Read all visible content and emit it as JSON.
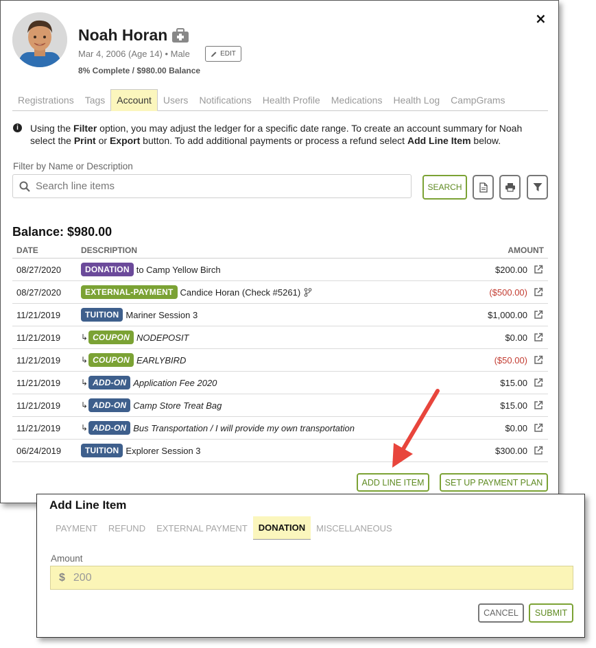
{
  "student": {
    "name": "Noah Horan",
    "meta": "Mar 4, 2006 (Age 14) • Male",
    "edit_label": "EDIT",
    "progress": "8% Complete / $980.00 Balance",
    "close_label": "×"
  },
  "tabs": [
    {
      "label": "Registrations",
      "active": false
    },
    {
      "label": "Tags",
      "active": false
    },
    {
      "label": "Account",
      "active": true
    },
    {
      "label": "Users",
      "active": false
    },
    {
      "label": "Notifications",
      "active": false
    },
    {
      "label": "Health Profile",
      "active": false
    },
    {
      "label": "Medications",
      "active": false
    },
    {
      "label": "Health Log",
      "active": false
    },
    {
      "label": "CampGrams",
      "active": false
    }
  ],
  "info": {
    "icon": "i",
    "t1": "Using the ",
    "b1": "Filter",
    "t2": " option, you may adjust the ledger for a specific date range. To create an account summary for Noah select the ",
    "b2": "Print",
    "t3": " or ",
    "b3": "Export",
    "t4": " button. To add additional payments or process a refund select ",
    "b4": "Add Line Item",
    "t5": " below."
  },
  "filter": {
    "label": "Filter by Name or Description",
    "placeholder": "Search line items",
    "search_label": "SEARCH"
  },
  "balance_label": "Balance: $980.00",
  "ledger": {
    "headers": {
      "date": "DATE",
      "description": "DESCRIPTION",
      "amount": "AMOUNT"
    },
    "rows": [
      {
        "date": "08/27/2020",
        "badge": "DONATION",
        "badge_color": "#6b4a9a",
        "desc": "to Camp Yellow Birch",
        "amount": "$200.00",
        "sub": false,
        "italic": false,
        "negative": false,
        "branch": false
      },
      {
        "date": "08/27/2020",
        "badge": "EXTERNAL-PAYMENT",
        "badge_color": "#7ba234",
        "desc": "Candice Horan (Check #5261)",
        "amount": "($500.00)",
        "sub": false,
        "italic": false,
        "negative": true,
        "branch": true
      },
      {
        "date": "11/21/2019",
        "badge": "TUITION",
        "badge_color": "#3e5f8c",
        "desc": "Mariner Session 3",
        "amount": "$1,000.00",
        "sub": false,
        "italic": false,
        "negative": false,
        "branch": false
      },
      {
        "date": "11/21/2019",
        "badge": "COUPON",
        "badge_color": "#7ba234",
        "desc": "NODEPOSIT",
        "amount": "$0.00",
        "sub": true,
        "italic": true,
        "negative": false,
        "branch": false
      },
      {
        "date": "11/21/2019",
        "badge": "COUPON",
        "badge_color": "#7ba234",
        "desc": "EARLYBIRD",
        "amount": "($50.00)",
        "sub": true,
        "italic": true,
        "negative": true,
        "branch": false
      },
      {
        "date": "11/21/2019",
        "badge": "ADD-ON",
        "badge_color": "#3e5f8c",
        "desc": "Application Fee 2020",
        "amount": "$15.00",
        "sub": true,
        "italic": true,
        "negative": false,
        "branch": false
      },
      {
        "date": "11/21/2019",
        "badge": "ADD-ON",
        "badge_color": "#3e5f8c",
        "desc": "Camp Store Treat Bag",
        "amount": "$15.00",
        "sub": true,
        "italic": true,
        "negative": false,
        "branch": false
      },
      {
        "date": "11/21/2019",
        "badge": "ADD-ON",
        "badge_color": "#3e5f8c",
        "desc": "Bus Transportation / I will provide my own transportation",
        "amount": "$0.00",
        "sub": true,
        "italic": true,
        "negative": false,
        "branch": false
      },
      {
        "date": "06/24/2019",
        "badge": "TUITION",
        "badge_color": "#3e5f8c",
        "desc": "Explorer Session 3",
        "amount": "$300.00",
        "sub": false,
        "italic": false,
        "negative": false,
        "branch": false
      }
    ]
  },
  "actions": {
    "add_line_item": "ADD LINE ITEM",
    "payment_plan": "SET UP PAYMENT PLAN"
  },
  "add_panel": {
    "title": "Add Line Item",
    "tabs": [
      {
        "label": "PAYMENT",
        "active": false
      },
      {
        "label": "REFUND",
        "active": false
      },
      {
        "label": "EXTERNAL PAYMENT",
        "active": false
      },
      {
        "label": "DONATION",
        "active": true
      },
      {
        "label": "MISCELLANEOUS",
        "active": false
      }
    ],
    "amount_label": "Amount",
    "currency": "$",
    "amount_value": "200",
    "cancel_label": "CANCEL",
    "submit_label": "SUBMIT"
  },
  "colors": {
    "accent_green": "#7ba234",
    "tab_highlight": "#fbf6bd",
    "negative_red": "#c23b30",
    "arrow_red": "#e8453c"
  }
}
